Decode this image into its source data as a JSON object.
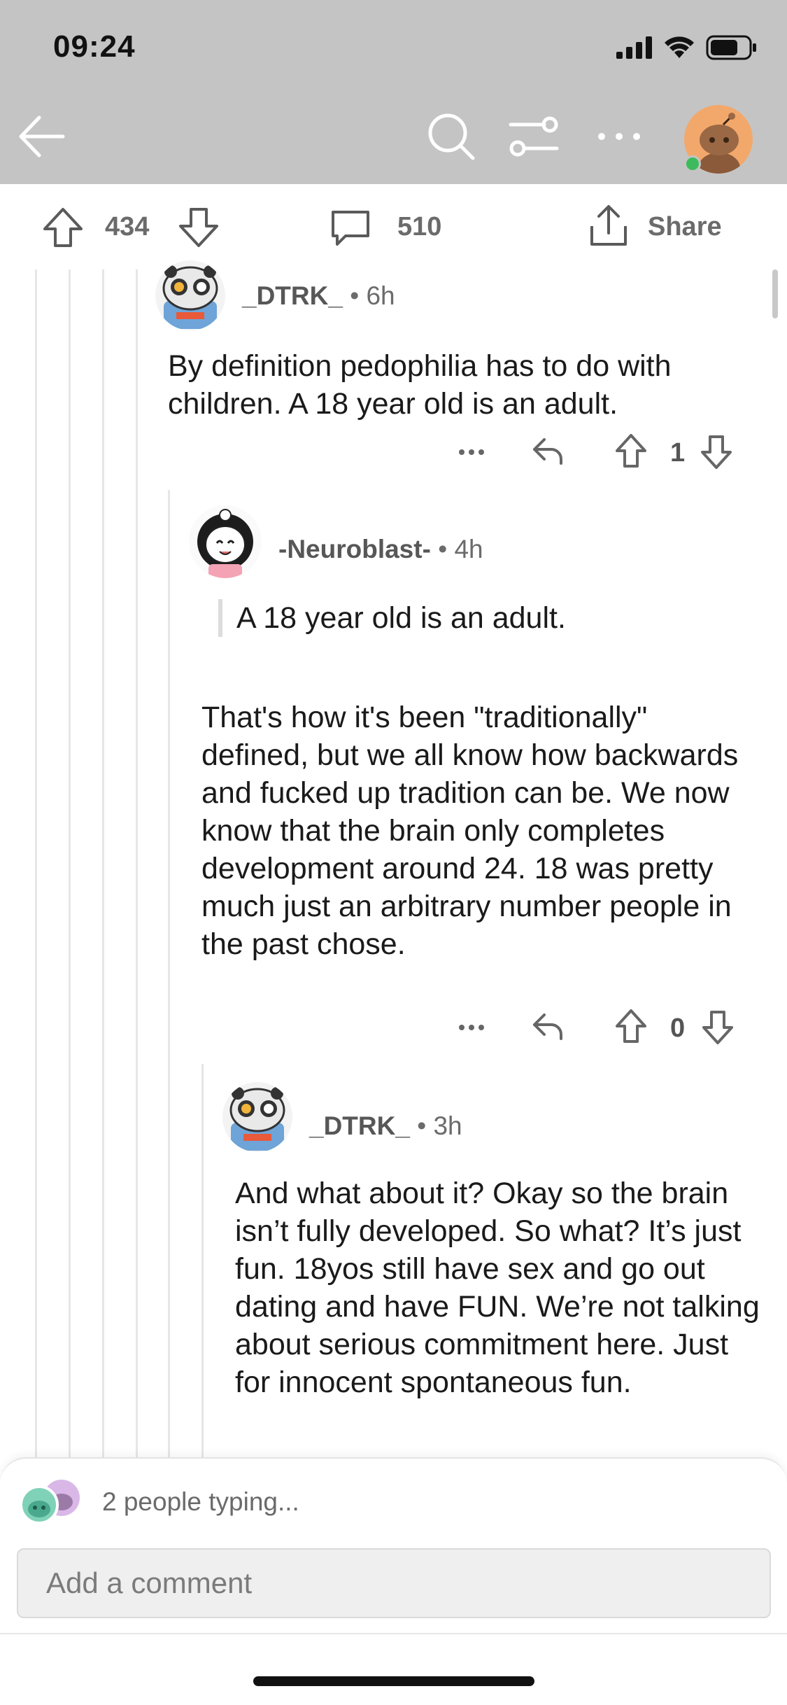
{
  "status_bar": {
    "time": "09:24"
  },
  "action_bar": {
    "upvotes": "434",
    "comments": "510",
    "share_label": "Share"
  },
  "comments": [
    {
      "author": "_DTRK_",
      "age": "6h",
      "body": "By definition pedophilia has to do with children. A 18 year old is an adult.",
      "votes": "1"
    },
    {
      "author": "-Neuroblast-",
      "age": "4h",
      "quote": "A 18 year old is an adult.",
      "body": "That's how it's been \"traditionally\" defined, but we all know how backwards and fucked up tradition can be. We now know that the brain only completes development around 24. 18 was pretty much just an arbitrary number people in the past chose.",
      "votes": "0"
    },
    {
      "author": "_DTRK_",
      "age": "3h",
      "body": "And what about it? Okay so the brain isn’t fully developed. So what? It’s just fun. 18yos still have sex and go out dating and have FUN. We’re not talking about serious commitment here. Just for innocent spontaneous fun."
    }
  ],
  "composer": {
    "typing_text": "2 people typing...",
    "placeholder": "Add a comment"
  },
  "separator": "•",
  "icons": {
    "back": "back-arrow-icon",
    "search": "search-icon",
    "filter": "filter-icon",
    "more": "more-icon",
    "upvote": "upvote-icon",
    "downvote": "downvote-icon",
    "comment": "comment-icon",
    "share": "share-icon",
    "reply": "reply-icon"
  },
  "colors": {
    "overlay_grey": "#c4c4c4",
    "online_green": "#3dbb5c",
    "avatar_orange": "#f2a86b"
  }
}
